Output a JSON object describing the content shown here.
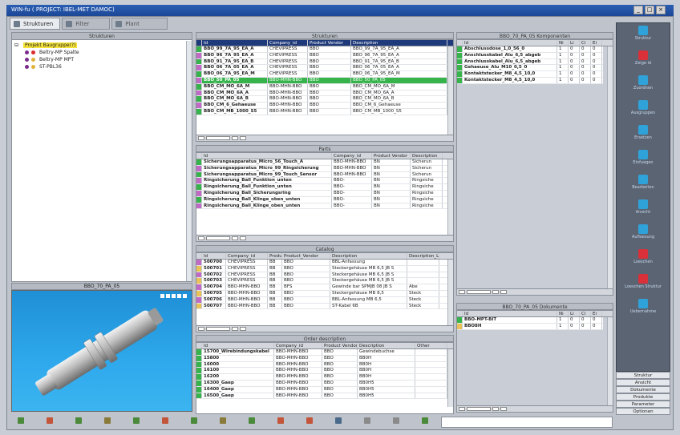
{
  "window": {
    "title": "WIN-fu ( PROJECT: IBEL-MET DAMOC)"
  },
  "tabs": [
    {
      "label": "Strukturen",
      "active": true
    },
    {
      "label": "Filter",
      "active": false
    },
    {
      "label": "Plant",
      "active": false
    }
  ],
  "left_panel": {
    "title": "Strukturen",
    "tree": [
      {
        "label": "Projekt Baugruppe(?)",
        "selected": true
      },
      {
        "label": "Beltry-MP Spalte",
        "selected": false
      },
      {
        "label": "Beltry-MP MPT",
        "selected": false
      },
      {
        "label": "ST-PBL36",
        "selected": false
      }
    ]
  },
  "viewer": {
    "title": "BBO_70_PA_05"
  },
  "grid1": {
    "title": "Strukturen",
    "columns": [
      "Id",
      "Company_id",
      "Product Vendor",
      "Description"
    ],
    "rows": [
      [
        "BBO_99_7A_95_EA_A",
        "CHEVIPRESS",
        "BBO",
        "BBO_99_7A_95_EA_A"
      ],
      [
        "BBO_96_7A_95_EA_A",
        "CHEVIPRESS",
        "BBO",
        "BBO_96_7A_95_EA_A"
      ],
      [
        "BBO_91_7A_95_EA_B",
        "CHEVIPRESS",
        "BBO",
        "BBO_91_7A_95_EA_B"
      ],
      [
        "BBO_06_7A_05_EA_A",
        "CHEVIPRESS",
        "BBO",
        "BBO_06_7A_05_EA_A"
      ],
      [
        "BBO_06_7A_95_EA_M",
        "CHEVIPRESS",
        "BBO",
        "BBO_06_7A_95_EA_M"
      ],
      [
        "BBO_50_PA_05",
        "BBO-MHN-BBO",
        "BBO",
        "BBO_50_PA_05"
      ],
      [
        "BBO_CM_MO_6A_M",
        "BBO-MHN-BBO",
        "BBO",
        "BBO_CM_MO_6A_M"
      ],
      [
        "BBO_CM_MO_6A_A",
        "BBO-MHN-BBO",
        "BBO",
        "BBO_CM_MO_6A_A"
      ],
      [
        "BBO_CM_MO_6A_B",
        "BBO-MHN-BBO",
        "BBO",
        "BBO_CM_MO_6A_B"
      ],
      [
        "BBO_CM_6_Gehaeuse",
        "BBO-MHN-BBO",
        "BBO",
        "BBO_CM_6_Gehaeuse"
      ],
      [
        "BBO_CM_MB_1000_S5",
        "BBO-MHN-BBO",
        "BBO",
        "BBO_CM_MB_1000_S5"
      ]
    ]
  },
  "grid2": {
    "title": "Parts",
    "columns": [
      "Id",
      "Company_id",
      "Product Vendor",
      "Description"
    ],
    "rows": [
      [
        "Sicherungsapparatus_Micro_56_Touch_A",
        "BBO-MHN-BBO",
        "BN",
        "Sicherun"
      ],
      [
        "Sicherungsapparatus_Micro_99_Ringsicherung",
        "BBO-MHN-BBO",
        "BN",
        "Sicherun"
      ],
      [
        "Sicherungsapparatus_Micro_99_Touch_Sensor",
        "BBO-MHN-BBO",
        "BN",
        "Sicherun"
      ],
      [
        "Ringsicherung_Ball_Funktion_unten",
        "BBO-",
        "BN",
        "Ringsiche"
      ],
      [
        "Ringsicherung_Ball_Funktion_unten",
        "BBO-",
        "BN",
        "Ringsiche"
      ],
      [
        "Ringsicherung_Ball_Sicherungsring",
        "BBO-",
        "BN",
        "Ringsiche"
      ],
      [
        "Ringsicherung_Ball_Klinge_oben_unten",
        "BBO-",
        "BN",
        "Ringsiche"
      ],
      [
        "Ringsicherung_Ball_Klinge_oben_unten",
        "BBO-",
        "BN",
        "Ringsiche"
      ]
    ]
  },
  "grid3": {
    "title": "Catalog",
    "columns": [
      "Id",
      "Company_id",
      "Product",
      "Product_Vendor",
      "Description",
      "Description_L"
    ],
    "rows": [
      [
        "500700",
        "CHEVIPRESS",
        "BB",
        "BBO",
        "BBL-Anfassung",
        ""
      ],
      [
        "500701",
        "CHEVIPRESS",
        "BB",
        "BBO",
        "Steckergehäuse MB 6,5 JB S",
        ""
      ],
      [
        "500702",
        "CHEVIPRESS",
        "BB",
        "BBO",
        "Steckergehäuse MB 6,5 JB S",
        ""
      ],
      [
        "500703",
        "CHEVIPRESS",
        "BB",
        "BBO",
        "Steckergehäuse MB 6,5 JB S",
        ""
      ],
      [
        "500704",
        "BBO-MHN-BBO",
        "BB",
        "BFS",
        "Gewinde bar SPMJB 08 JB S",
        "Abe"
      ],
      [
        "500705",
        "BBO-MHN-BBO",
        "BB",
        "BBO",
        "Steckergehäuse MB 8,5",
        "Steck"
      ],
      [
        "500706",
        "BBO-MHN-BBO",
        "BB",
        "BBO",
        "BBL-Anfassung MB 6,5",
        "Steck"
      ],
      [
        "500707",
        "BBO-MHN-BBO",
        "BB",
        "BBO",
        "ST-Kabel 6B",
        "Steck"
      ]
    ]
  },
  "grid4": {
    "title": "Order description",
    "columns": [
      "Id",
      "Company_id",
      "Product Vendor",
      "Description",
      "Other"
    ],
    "rows": [
      [
        "15700_Wirebindungskabel",
        "BBO-MHN-BBO",
        "BBO",
        "Gewindebuchse",
        ""
      ],
      [
        "15800",
        "BBO-MHN-BBO",
        "BBO",
        "BB0H",
        ""
      ],
      [
        "16000",
        "BBO-MHN-BBO",
        "BBO",
        "BB0H",
        ""
      ],
      [
        "16100",
        "BBO-MHN-BBO",
        "BBO",
        "BB0H",
        ""
      ],
      [
        "16200",
        "BBO-MHN-BBO",
        "BBO",
        "BB0H",
        ""
      ],
      [
        "16300_Gaep",
        "BBO-MHN-BBO",
        "BBO",
        "BB0H5",
        ""
      ],
      [
        "16400_Gaep",
        "BBO-MHN-BBO",
        "BBO",
        "BB0H5",
        ""
      ],
      [
        "16500_Gaep",
        "BBO-MHN-BBO",
        "BBO",
        "BB0H5",
        ""
      ]
    ]
  },
  "grid5": {
    "title": "BBO_70_PA_05 Komponenten",
    "columns": [
      "Id",
      "Ni",
      "Li",
      "Ci",
      "Ei"
    ],
    "rows": [
      [
        "Abschlussdose_1,0_56_0",
        "1",
        "0",
        "0",
        "0"
      ],
      [
        "Anschlusskabel_Alu_6,5_abgeb",
        "1",
        "0",
        "0",
        "0"
      ],
      [
        "Anschlusskabel_Alu_6,5_abgeb",
        "1",
        "0",
        "0",
        "0"
      ],
      [
        "Gehaeuse_Alu_M10_0,5_0",
        "1",
        "0",
        "0",
        "0"
      ],
      [
        "Kontaktstecker_M8_4,5_10,0",
        "1",
        "0",
        "0",
        "0"
      ],
      [
        "Kontaktstecker_M8_4,5_10,0",
        "1",
        "0",
        "0",
        "0"
      ]
    ]
  },
  "grid6": {
    "title": "BBO_70_PA_05 Dokumente",
    "columns": [
      "Id",
      "Ni",
      "Li",
      "Ci",
      "Ei"
    ],
    "rows": [
      [
        "BBO-MPT-BIT",
        "1",
        "0",
        "0",
        "0"
      ],
      [
        "BBO8H",
        "1",
        "0",
        "0",
        "0"
      ]
    ]
  },
  "sidebar": {
    "buttons": [
      {
        "label": "Struktur",
        "color": "#2fa3d9"
      },
      {
        "label": "Zeige Id",
        "color": "#d9303a"
      },
      {
        "label": "Zuordnen",
        "color": "#2fa3d9"
      },
      {
        "label": "Ausgruppen",
        "color": "#2fa3d9"
      },
      {
        "label": "Ersetzen",
        "color": "#2fa3d9"
      },
      {
        "label": "Einfuegen",
        "color": "#2fa3d9"
      },
      {
        "label": "Bearbeiten",
        "color": "#2fa3d9"
      },
      {
        "label": "Ansicht",
        "color": "#2fa3d9"
      },
      {
        "label": "Aufloesung",
        "color": "#2fa3d9"
      },
      {
        "label": "Loeschen",
        "color": "#d9303a"
      },
      {
        "label": "Loeschen Struktur",
        "color": "#d9303a"
      },
      {
        "label": "Uebernahme",
        "color": "#2fa3d9"
      }
    ],
    "bottom": [
      "Struktur",
      "Ansicht",
      "Dokumente",
      "Produkte",
      "Parameter",
      "Optionen"
    ]
  },
  "status": {
    "input_value": ""
  }
}
